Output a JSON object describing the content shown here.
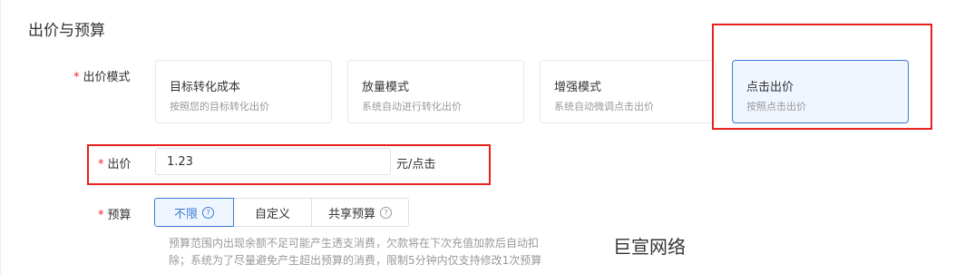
{
  "section": {
    "title": "出价与预算"
  },
  "bid_mode": {
    "label": "出价模式",
    "required": "*",
    "options": [
      {
        "title": "目标转化成本",
        "desc": "按照您的目标转化出价"
      },
      {
        "title": "放量模式",
        "desc": "系统自动进行转化出价"
      },
      {
        "title": "增强模式",
        "desc": "系统自动微调点击出价"
      },
      {
        "title": "点击出价",
        "desc": "按照点击出价"
      }
    ],
    "selected": "点击出价"
  },
  "bid": {
    "label": "出价",
    "required": "*",
    "value": "1.23",
    "unit": "元/点击"
  },
  "budget": {
    "label": "预算",
    "required": "*",
    "options": [
      "不限",
      "自定义",
      "共享预算"
    ],
    "selected": "不限",
    "hint_line1": "预算范围内出现余额不足可能产生透支消费，欠款将在下次充值加款后自动扣",
    "hint_line2": "除；系统为了尽量避免产生超出预算的消费，限制5分钟内仅支持修改1次预算"
  },
  "watermark": "巨宣网络",
  "colors": {
    "accent": "#3a7bd5",
    "annotation_red": "#e8211d",
    "required": "#f5222d"
  },
  "icons": {
    "help": "question-circle-icon"
  }
}
